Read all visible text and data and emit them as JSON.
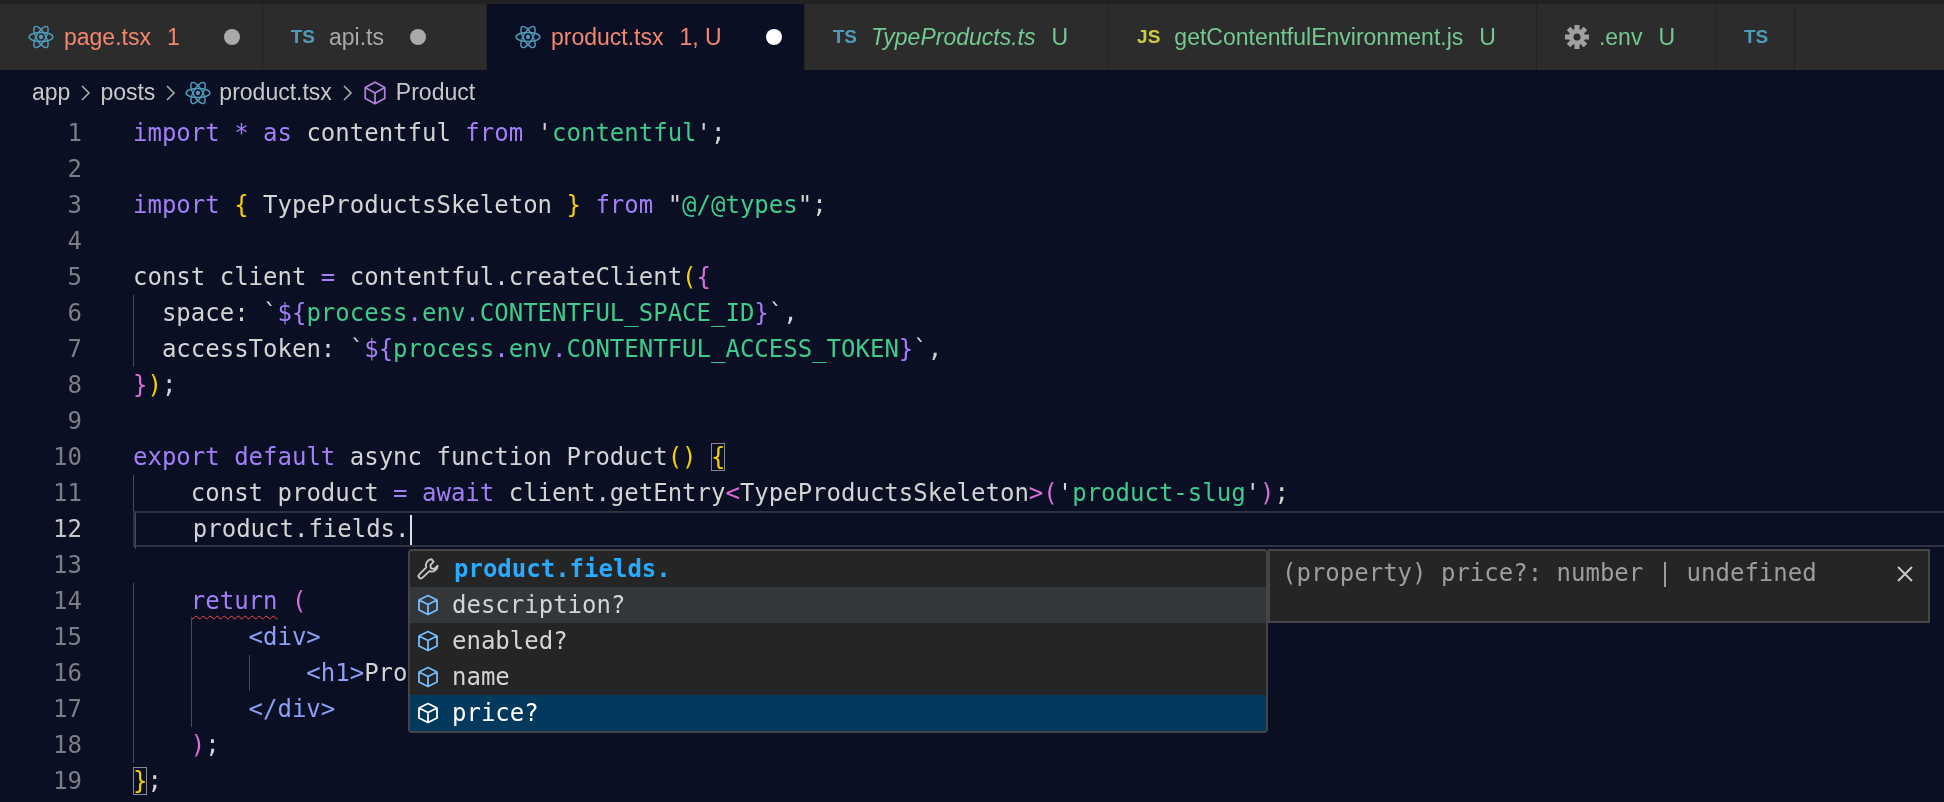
{
  "tabs": [
    {
      "kind": "react",
      "label": "page.tsx",
      "badge": "1",
      "color": "#f48771",
      "preview": false,
      "dirty": true,
      "selected": false
    },
    {
      "kind": "ts",
      "icon_text": "TS",
      "label": "api.ts",
      "color": "#a9a9a9",
      "preview": false,
      "dirty": true,
      "selected": false
    },
    {
      "kind": "react",
      "label": "product.tsx",
      "badge": "1, U",
      "color": "#f48771",
      "preview": false,
      "dirty": true,
      "selected": true
    },
    {
      "kind": "ts",
      "icon_text": "TS",
      "label": "TypeProducts.ts",
      "badge": "U",
      "color": "#73c991",
      "preview": true,
      "dirty": false,
      "selected": false
    },
    {
      "kind": "js",
      "icon_text": "JS",
      "label": "getContentfulEnvironment.js",
      "badge": "U",
      "color": "#73c991",
      "preview": false,
      "dirty": false,
      "selected": false
    },
    {
      "kind": "gear",
      "label": ".env",
      "badge": "U",
      "color": "#73c991",
      "preview": false,
      "dirty": false,
      "selected": false
    },
    {
      "kind": "ts",
      "icon_text": "TS",
      "preview": false,
      "dirty": false,
      "selected": false
    }
  ],
  "breadcrumbs": [
    {
      "kind": "folder",
      "label": "app"
    },
    {
      "kind": "folder",
      "label": "posts"
    },
    {
      "kind": "react",
      "label": "product.tsx"
    },
    {
      "kind": "symbol",
      "label": "Product"
    }
  ],
  "lines": [
    {
      "number": "1",
      "current": false,
      "tokens": [
        {
          "kind": "keyword",
          "text": "import "
        },
        {
          "kind": "operator",
          "text": "*"
        },
        {
          "kind": "keyword",
          "text": " as"
        },
        {
          "kind": "text",
          "text": " contentful "
        },
        {
          "kind": "keyword",
          "text": "from"
        },
        {
          "kind": "text",
          "text": " '"
        },
        {
          "kind": "string",
          "text": "contentful"
        },
        {
          "kind": "text",
          "text": "';"
        }
      ]
    },
    {
      "number": "2",
      "current": false
    },
    {
      "number": "3",
      "current": false,
      "tokens": [
        {
          "kind": "keyword",
          "text": "import "
        },
        {
          "kind": "gold",
          "text": "{"
        },
        {
          "kind": "text",
          "text": " TypeProductsSkeleton "
        },
        {
          "kind": "gold",
          "text": "}"
        },
        {
          "kind": "keyword",
          "text": " from"
        },
        {
          "kind": "text",
          "text": " \""
        },
        {
          "kind": "string",
          "text": "@/@types"
        },
        {
          "kind": "text",
          "text": "\";"
        }
      ]
    },
    {
      "number": "4",
      "current": false
    },
    {
      "number": "5",
      "current": false,
      "tokens": [
        {
          "kind": "text",
          "text": "const client "
        },
        {
          "kind": "operator",
          "text": "="
        },
        {
          "kind": "text",
          "text": " contentful.createClient"
        },
        {
          "kind": "gold",
          "text": "("
        },
        {
          "kind": "pink",
          "text": "{"
        }
      ]
    },
    {
      "number": "6",
      "current": false,
      "tokens": [
        {
          "kind": "text",
          "text": "  space: `"
        },
        {
          "kind": "operator",
          "text": "${"
        },
        {
          "kind": "string",
          "text": "process"
        },
        {
          "kind": "operator",
          "text": "."
        },
        {
          "kind": "string",
          "text": "env"
        },
        {
          "kind": "operator",
          "text": "."
        },
        {
          "kind": "string",
          "text": "CONTENTFUL_SPACE_ID"
        },
        {
          "kind": "operator",
          "text": "}"
        },
        {
          "kind": "text",
          "text": "`,"
        }
      ]
    },
    {
      "number": "7",
      "current": false,
      "tokens": [
        {
          "kind": "text",
          "text": "  accessToken: `"
        },
        {
          "kind": "operator",
          "text": "${"
        },
        {
          "kind": "string",
          "text": "process"
        },
        {
          "kind": "operator",
          "text": "."
        },
        {
          "kind": "string",
          "text": "env"
        },
        {
          "kind": "operator",
          "text": "."
        },
        {
          "kind": "string",
          "text": "CONTENTFUL_ACCESS_TOKEN"
        },
        {
          "kind": "operator",
          "text": "}"
        },
        {
          "kind": "text",
          "text": "`,"
        }
      ]
    },
    {
      "number": "8",
      "current": false,
      "tokens": [
        {
          "kind": "pink",
          "text": "}"
        },
        {
          "kind": "gold",
          "text": ")"
        },
        {
          "kind": "text",
          "text": ";"
        }
      ]
    },
    {
      "number": "9",
      "current": false
    },
    {
      "number": "10",
      "current": false,
      "tokens": [
        {
          "kind": "keyword",
          "text": "export default"
        },
        {
          "kind": "text",
          "text": " async function Product"
        },
        {
          "kind": "gold",
          "text": "() "
        },
        {
          "kind": "bracket-match",
          "text": "{"
        }
      ]
    },
    {
      "number": "11",
      "current": false,
      "tokens": [
        {
          "kind": "text",
          "text": "    const product "
        },
        {
          "kind": "operator",
          "text": "="
        },
        {
          "kind": "keyword",
          "text": " await"
        },
        {
          "kind": "text",
          "text": " client.getEntry"
        },
        {
          "kind": "pink",
          "text": "<"
        },
        {
          "kind": "text",
          "text": "TypeProductsSkeleton"
        },
        {
          "kind": "pink",
          "text": ">("
        },
        {
          "kind": "text",
          "text": "'"
        },
        {
          "kind": "string",
          "text": "product-slug"
        },
        {
          "kind": "text",
          "text": "'"
        },
        {
          "kind": "pink",
          "text": ")"
        },
        {
          "kind": "text",
          "text": ";"
        }
      ]
    },
    {
      "number": "12",
      "current": true,
      "tokens": [
        {
          "kind": "text",
          "text": "    product.fields."
        }
      ]
    },
    {
      "number": "13",
      "current": false
    },
    {
      "number": "14",
      "current": false,
      "tokens": [
        {
          "kind": "keyword-error",
          "text": "    return"
        },
        {
          "kind": "pink",
          "text": " ("
        }
      ]
    },
    {
      "number": "15",
      "current": false,
      "tokens": [
        {
          "kind": "tag",
          "text": "        <div>"
        }
      ]
    },
    {
      "number": "16",
      "current": false,
      "tokens": [
        {
          "kind": "tag",
          "text": "            <h1>"
        },
        {
          "kind": "text",
          "text": "Pro"
        }
      ]
    },
    {
      "number": "17",
      "current": false,
      "tokens": [
        {
          "kind": "tag",
          "text": "        </div>"
        }
      ]
    },
    {
      "number": "18",
      "current": false,
      "tokens": [
        {
          "kind": "pink",
          "text": "    )"
        },
        {
          "kind": "text",
          "text": ";"
        }
      ]
    },
    {
      "number": "19",
      "current": false,
      "tokens": [
        {
          "kind": "bracket-match",
          "text": "}"
        },
        {
          "kind": "text",
          "text": ";"
        }
      ]
    }
  ],
  "suggest": {
    "items": [
      {
        "kind": "snippet",
        "label": "product.fields.",
        "selected": false,
        "hovered": false
      },
      {
        "kind": "field",
        "label": "description?",
        "selected": false,
        "hovered": true
      },
      {
        "kind": "field",
        "label": "enabled?",
        "selected": false,
        "hovered": false
      },
      {
        "kind": "field",
        "label": "name",
        "selected": false,
        "hovered": false
      },
      {
        "kind": "field",
        "label": "price?",
        "selected": true,
        "hovered": false
      }
    ],
    "details": "(property) price?: number | undefined"
  }
}
